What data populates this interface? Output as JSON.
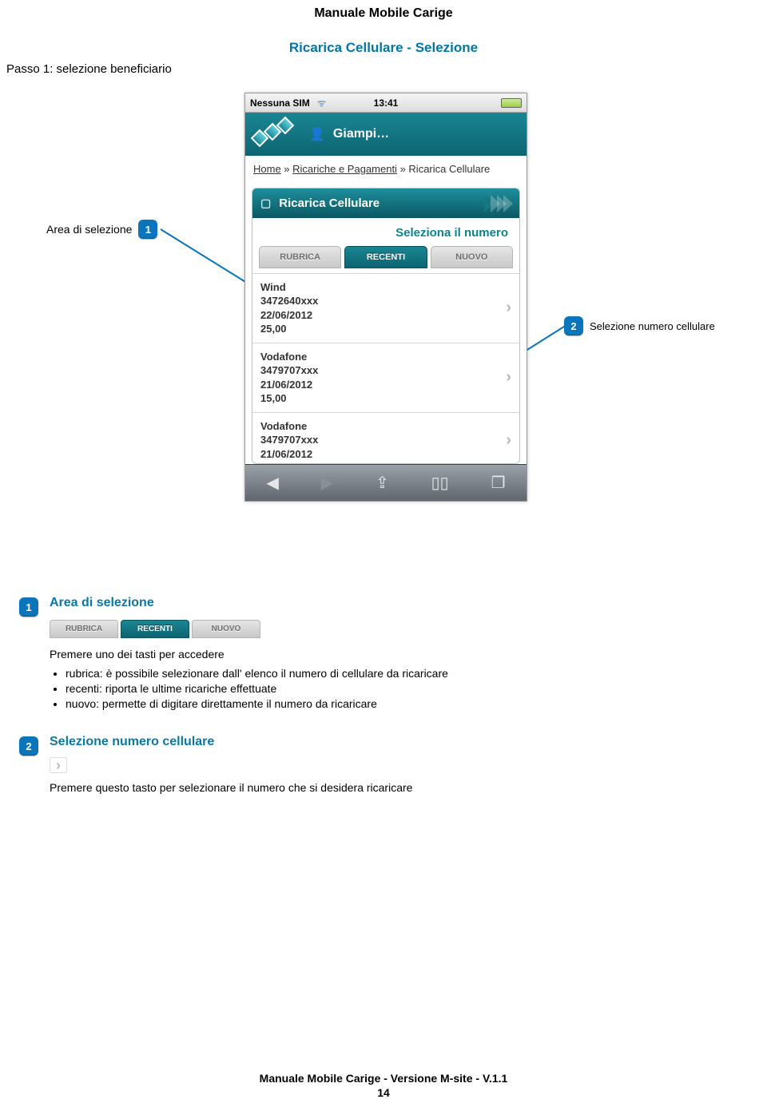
{
  "doc": {
    "header": "Manuale Mobile Carige",
    "section_title": "Ricarica Cellulare - Selezione",
    "step": "Passo 1: selezione beneficiario",
    "footer": "Manuale Mobile Carige - Versione M-site - V.1.1",
    "page_number": "14"
  },
  "callouts": {
    "left_label": "Area di selezione",
    "left_num": "1",
    "right_num": "2",
    "right_label": "Selezione numero cellulare"
  },
  "phone": {
    "status": {
      "sim": "Nessuna SIM",
      "time": "13:41"
    },
    "header_user": "Giampi…",
    "breadcrumb": {
      "home": "Home",
      "sep1": " » ",
      "l2": "Ricariche e Pagamenti",
      "sep2": " » ",
      "l3": "Ricarica Cellulare"
    },
    "panel_title": "Ricarica Cellulare",
    "panel_sub": "Seleziona il numero",
    "tabs": {
      "rubrica": "RUBRICA",
      "recenti": "RECENTI",
      "nuovo": "NUOVO"
    },
    "rows": [
      {
        "op": "Wind",
        "num": "3472640xxx",
        "date": "22/06/2012",
        "amount": "25,00"
      },
      {
        "op": "Vodafone",
        "num": "3479707xxx",
        "date": "21/06/2012",
        "amount": "15,00"
      },
      {
        "op": "Vodafone",
        "num": "3479707xxx",
        "date": "21/06/2012",
        "amount": ""
      }
    ]
  },
  "legend": {
    "item1": {
      "num": "1",
      "title": "Area di selezione",
      "intro": "Premere uno dei tasti per accedere",
      "b1": "rubrica: è possibile selezionare dall' elenco il numero di cellulare da ricaricare",
      "b2": "recenti: riporta le ultime ricariche effettuate",
      "b3": "nuovo: permette di digitare direttamente il numero da ricaricare"
    },
    "item2": {
      "num": "2",
      "title": "Selezione numero cellulare",
      "text": "Premere questo tasto per selezionare il numero che si desidera ricaricare"
    }
  }
}
